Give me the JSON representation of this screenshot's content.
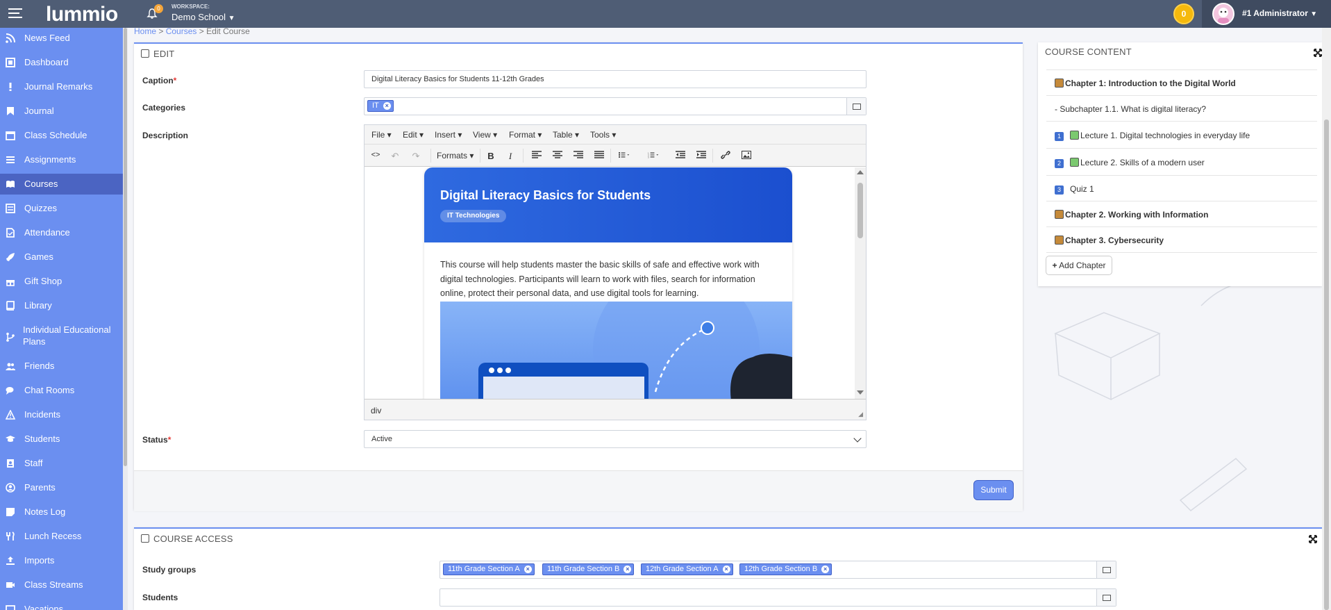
{
  "topbar": {
    "logo": "lummio",
    "notifications_count": "0",
    "workspace_label": "WORKSPACE:",
    "workspace_name": "Demo School",
    "coins": "0",
    "user_name": "#1 Administrator"
  },
  "sidebar": {
    "items": [
      {
        "label": "News Feed",
        "icon": "rss-icon"
      },
      {
        "label": "Dashboard",
        "icon": "dashboard-icon"
      },
      {
        "label": "Journal Remarks",
        "icon": "exclamation-icon"
      },
      {
        "label": "Journal",
        "icon": "bookmark-icon"
      },
      {
        "label": "Class Schedule",
        "icon": "calendar-icon"
      },
      {
        "label": "Assignments",
        "icon": "list-icon"
      },
      {
        "label": "Courses",
        "icon": "book-open-icon",
        "active": true
      },
      {
        "label": "Quizzes",
        "icon": "checklist-icon"
      },
      {
        "label": "Attendance",
        "icon": "file-check-icon"
      },
      {
        "label": "Games",
        "icon": "rocket-icon"
      },
      {
        "label": "Gift Shop",
        "icon": "gift-icon"
      },
      {
        "label": "Library",
        "icon": "book-icon"
      },
      {
        "label": "Individual Educational Plans",
        "icon": "branch-icon"
      },
      {
        "label": "Friends",
        "icon": "users-icon"
      },
      {
        "label": "Chat Rooms",
        "icon": "chat-icon"
      },
      {
        "label": "Incidents",
        "icon": "warning-icon"
      },
      {
        "label": "Students",
        "icon": "graduation-cap-icon"
      },
      {
        "label": "Staff",
        "icon": "id-badge-icon"
      },
      {
        "label": "Parents",
        "icon": "user-circle-icon"
      },
      {
        "label": "Notes Log",
        "icon": "note-icon"
      },
      {
        "label": "Lunch Recess",
        "icon": "utensils-icon"
      },
      {
        "label": "Imports",
        "icon": "upload-icon"
      },
      {
        "label": "Class Streams",
        "icon": "video-icon"
      },
      {
        "label": "Vacations",
        "icon": "calendar-icon"
      }
    ]
  },
  "breadcrumb": {
    "home": "Home",
    "sep1": " > ",
    "courses": "Courses",
    "sep2": " > ",
    "current": "Edit Course"
  },
  "edit_panel": {
    "title": "EDIT",
    "caption_label": "Caption",
    "caption_value": "Digital Literacy Basics for Students 11-12th Grades",
    "categories_label": "Categories",
    "categories": [
      "IT"
    ],
    "description_label": "Description",
    "status_label": "Status",
    "status_value": "Active",
    "submit_label": "Submit"
  },
  "editor": {
    "menus": [
      "File",
      "Edit",
      "Insert",
      "View",
      "Format",
      "Table",
      "Tools"
    ],
    "formats_label": "Formats",
    "statusbar_path": "div",
    "card_title": "Digital Literacy Basics for Students",
    "card_badge": "IT Technologies",
    "card_text": "This course will help students master the basic skills of safe and effective work with digital technologies. Participants will learn to work with files, search for information online, protect their personal data, and use digital tools for learning."
  },
  "course_content": {
    "title": "COURSE CONTENT",
    "items": [
      {
        "kind": "chapter",
        "text": "Chapter 1: Introduction to the Digital World"
      },
      {
        "kind": "sub",
        "text": "- Subchapter 1.1. What is digital literacy?"
      },
      {
        "kind": "lecture",
        "num": "1",
        "text": "Lecture 1. Digital technologies in everyday life"
      },
      {
        "kind": "lecture",
        "num": "2",
        "text": "Lecture 2. Skills of a modern user"
      },
      {
        "kind": "quiz",
        "num": "3",
        "text": "Quiz 1"
      },
      {
        "kind": "chapter",
        "text": "Chapter 2. Working with Information"
      },
      {
        "kind": "chapter",
        "text": "Chapter 3. Cybersecurity"
      }
    ],
    "add_chapter_label": "Add Chapter"
  },
  "access_panel": {
    "title": "COURSE ACCESS",
    "study_groups_label": "Study groups",
    "study_groups": [
      "11th Grade Section A",
      "11th Grade Section B",
      "12th Grade Section A",
      "12th Grade Section B"
    ],
    "students_label": "Students"
  },
  "colors": {
    "topbar": "#4f5d75",
    "sidebar": "#6b8ff0",
    "sidebar_active": "#4b64c2",
    "accent": "#6b8ff0",
    "coin": "#f5b90d"
  }
}
